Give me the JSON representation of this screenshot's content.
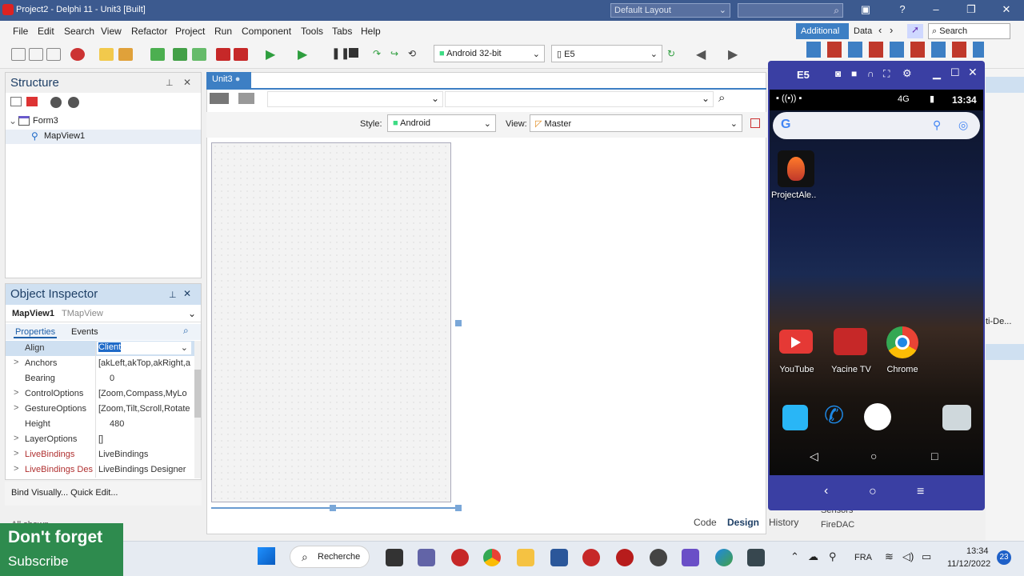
{
  "window": {
    "title": "Project2 - Delphi 11 - Unit3 [Built]",
    "layout": "Default Layout",
    "search_placeholder": "Search",
    "help": "?"
  },
  "menu": [
    "File",
    "Edit",
    "Search",
    "View",
    "Refactor",
    "Project",
    "Run",
    "Component",
    "Tools",
    "Tabs",
    "Help"
  ],
  "toolbar": {
    "platform": "Android 32-bit",
    "device": "E5"
  },
  "palette": {
    "tabs": [
      "Additional",
      "Data"
    ],
    "search": "Search"
  },
  "structure": {
    "title": "Structure",
    "tree": [
      {
        "label": "Form3"
      },
      {
        "label": "MapView1"
      }
    ]
  },
  "object_inspector": {
    "title": "Object Inspector",
    "object_name": "MapView1",
    "object_type": "TMapView",
    "tabs": [
      "Properties",
      "Events"
    ],
    "rows": [
      {
        "name": "Align",
        "value": "Client",
        "expand": ""
      },
      {
        "name": "Anchors",
        "value": "[akLeft,akTop,akRight,a",
        "expand": ">"
      },
      {
        "name": "Bearing",
        "value": "0",
        "expand": ""
      },
      {
        "name": "ControlOptions",
        "value": "[Zoom,Compass,MyLo",
        "expand": ">"
      },
      {
        "name": "GestureOptions",
        "value": "[Zoom,Tilt,Scroll,Rotate",
        "expand": ">"
      },
      {
        "name": "Height",
        "value": "480",
        "expand": ""
      },
      {
        "name": "LayerOptions",
        "value": "[]",
        "expand": ">"
      },
      {
        "name": "LiveBindings",
        "value": "LiveBindings",
        "expand": ">"
      },
      {
        "name": "LiveBindings Des",
        "value": "LiveBindings Designer",
        "expand": ">"
      }
    ],
    "footer": "Bind Visually...  Quick Edit...",
    "footer2": "All shown"
  },
  "designer": {
    "tab": "Unit3",
    "style_label": "Style:",
    "style_value": "Android",
    "view_label": "View:",
    "view_value": "Master",
    "bottom_tabs": [
      "Code",
      "Design",
      "History"
    ]
  },
  "emulator": {
    "title": "E5",
    "status_time": "13:34",
    "status_net": "4G",
    "apps": [
      {
        "label": "ProjectAle..",
        "color": "#c0392b"
      },
      {
        "label": "YouTube",
        "color": "#e53935"
      },
      {
        "label": "Yacine TV",
        "color": "#c62828"
      },
      {
        "label": "Chrome",
        "color": "#1e88e5"
      }
    ],
    "dock_colors": [
      "#29b6f6",
      "#1e88e5",
      "#ffffff",
      "#546e7a"
    ]
  },
  "tool_palette_items": [
    "Sensors",
    "FireDAC"
  ],
  "right_panel_text": "ti-De...",
  "taskbar": {
    "search": "Recherche",
    "lang": "FRA",
    "time": "13:34",
    "date": "11/12/2022",
    "badge": "23"
  },
  "overlay": {
    "line1": "Don't forget",
    "line2": "Subscribe"
  },
  "colors": {
    "title_bar": "#3c5a8f",
    "panel_header": "#cfe0f1",
    "emulator_frame": "#3a3fa3",
    "accent": "#1e90ff",
    "subscribe_bg": "#2e8b4e"
  }
}
